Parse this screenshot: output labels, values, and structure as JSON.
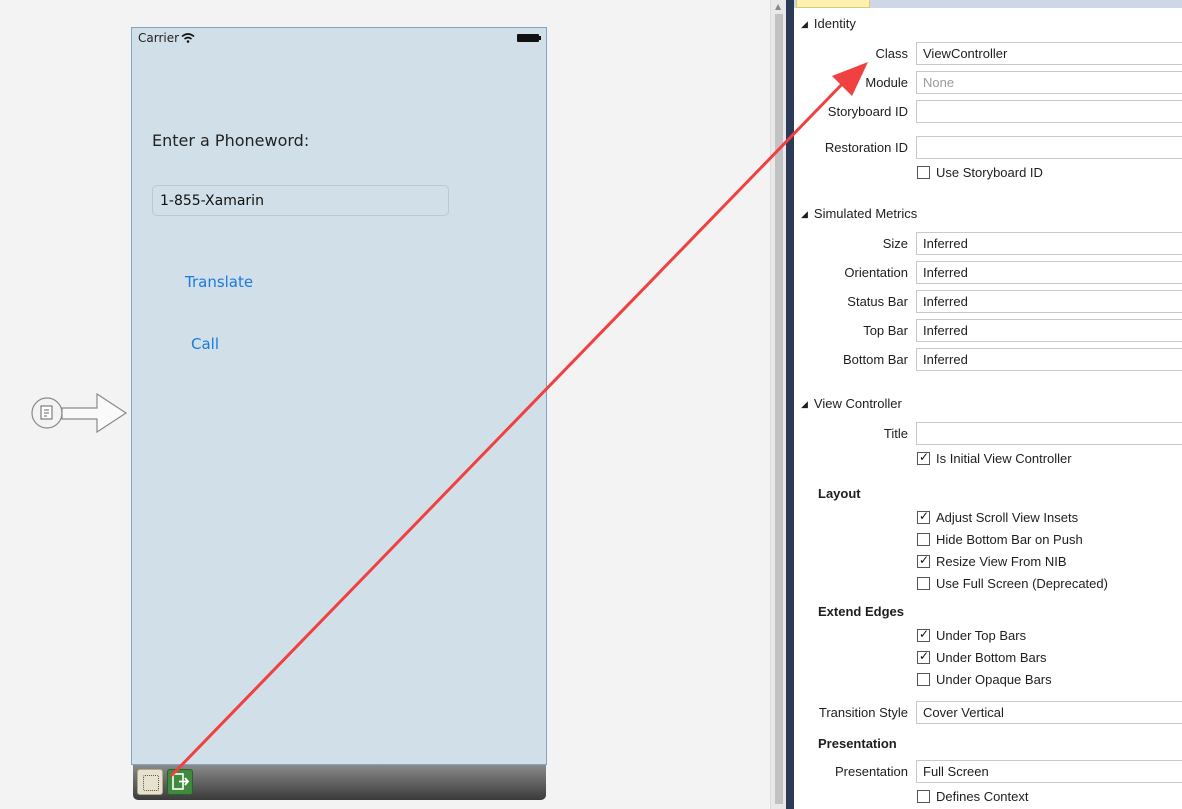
{
  "phone": {
    "carrier": "Carrier",
    "prompt": "Enter a Phoneword:",
    "field_value": "1-855-Xamarin",
    "translate": "Translate",
    "call": "Call"
  },
  "properties": {
    "identity": {
      "title": "Identity",
      "class_label": "Class",
      "class_value": "ViewController",
      "module_label": "Module",
      "module_placeholder": "None",
      "storyboard_id_label": "Storyboard ID",
      "restoration_id_label": "Restoration ID",
      "use_storyboard_id": "Use Storyboard ID"
    },
    "simulated": {
      "title": "Simulated Metrics",
      "size_label": "Size",
      "size_value": "Inferred",
      "orientation_label": "Orientation",
      "orientation_value": "Inferred",
      "status_bar_label": "Status Bar",
      "status_bar_value": "Inferred",
      "top_bar_label": "Top Bar",
      "top_bar_value": "Inferred",
      "bottom_bar_label": "Bottom Bar",
      "bottom_bar_value": "Inferred"
    },
    "view_controller": {
      "title": "View Controller",
      "title_label": "Title",
      "is_initial": "Is Initial View Controller",
      "layout_title": "Layout",
      "adjust_scroll": "Adjust Scroll View Insets",
      "hide_bottom_bar": "Hide Bottom Bar on Push",
      "resize_nib": "Resize View From NIB",
      "use_full_screen": "Use Full Screen (Deprecated)",
      "extend_edges_title": "Extend Edges",
      "under_top_bars": "Under Top Bars",
      "under_bottom_bars": "Under Bottom Bars",
      "under_opaque_bars": "Under Opaque Bars",
      "transition_label": "Transition Style",
      "transition_value": "Cover Vertical",
      "presentation_title": "Presentation",
      "presentation_label": "Presentation",
      "presentation_value": "Full Screen",
      "defines_context": "Defines Context"
    }
  },
  "checks": {
    "use_storyboard_id": false,
    "is_initial": true,
    "adjust_scroll": true,
    "hide_bottom_bar": false,
    "resize_nib": true,
    "use_full_screen": false,
    "under_top_bars": true,
    "under_bottom_bars": true,
    "under_opaque_bars": false,
    "defines_context": false
  },
  "colors": {
    "annotation_arrow": "#f04040",
    "link": "#1b7adf",
    "phone_background": "#d1dfe9"
  }
}
